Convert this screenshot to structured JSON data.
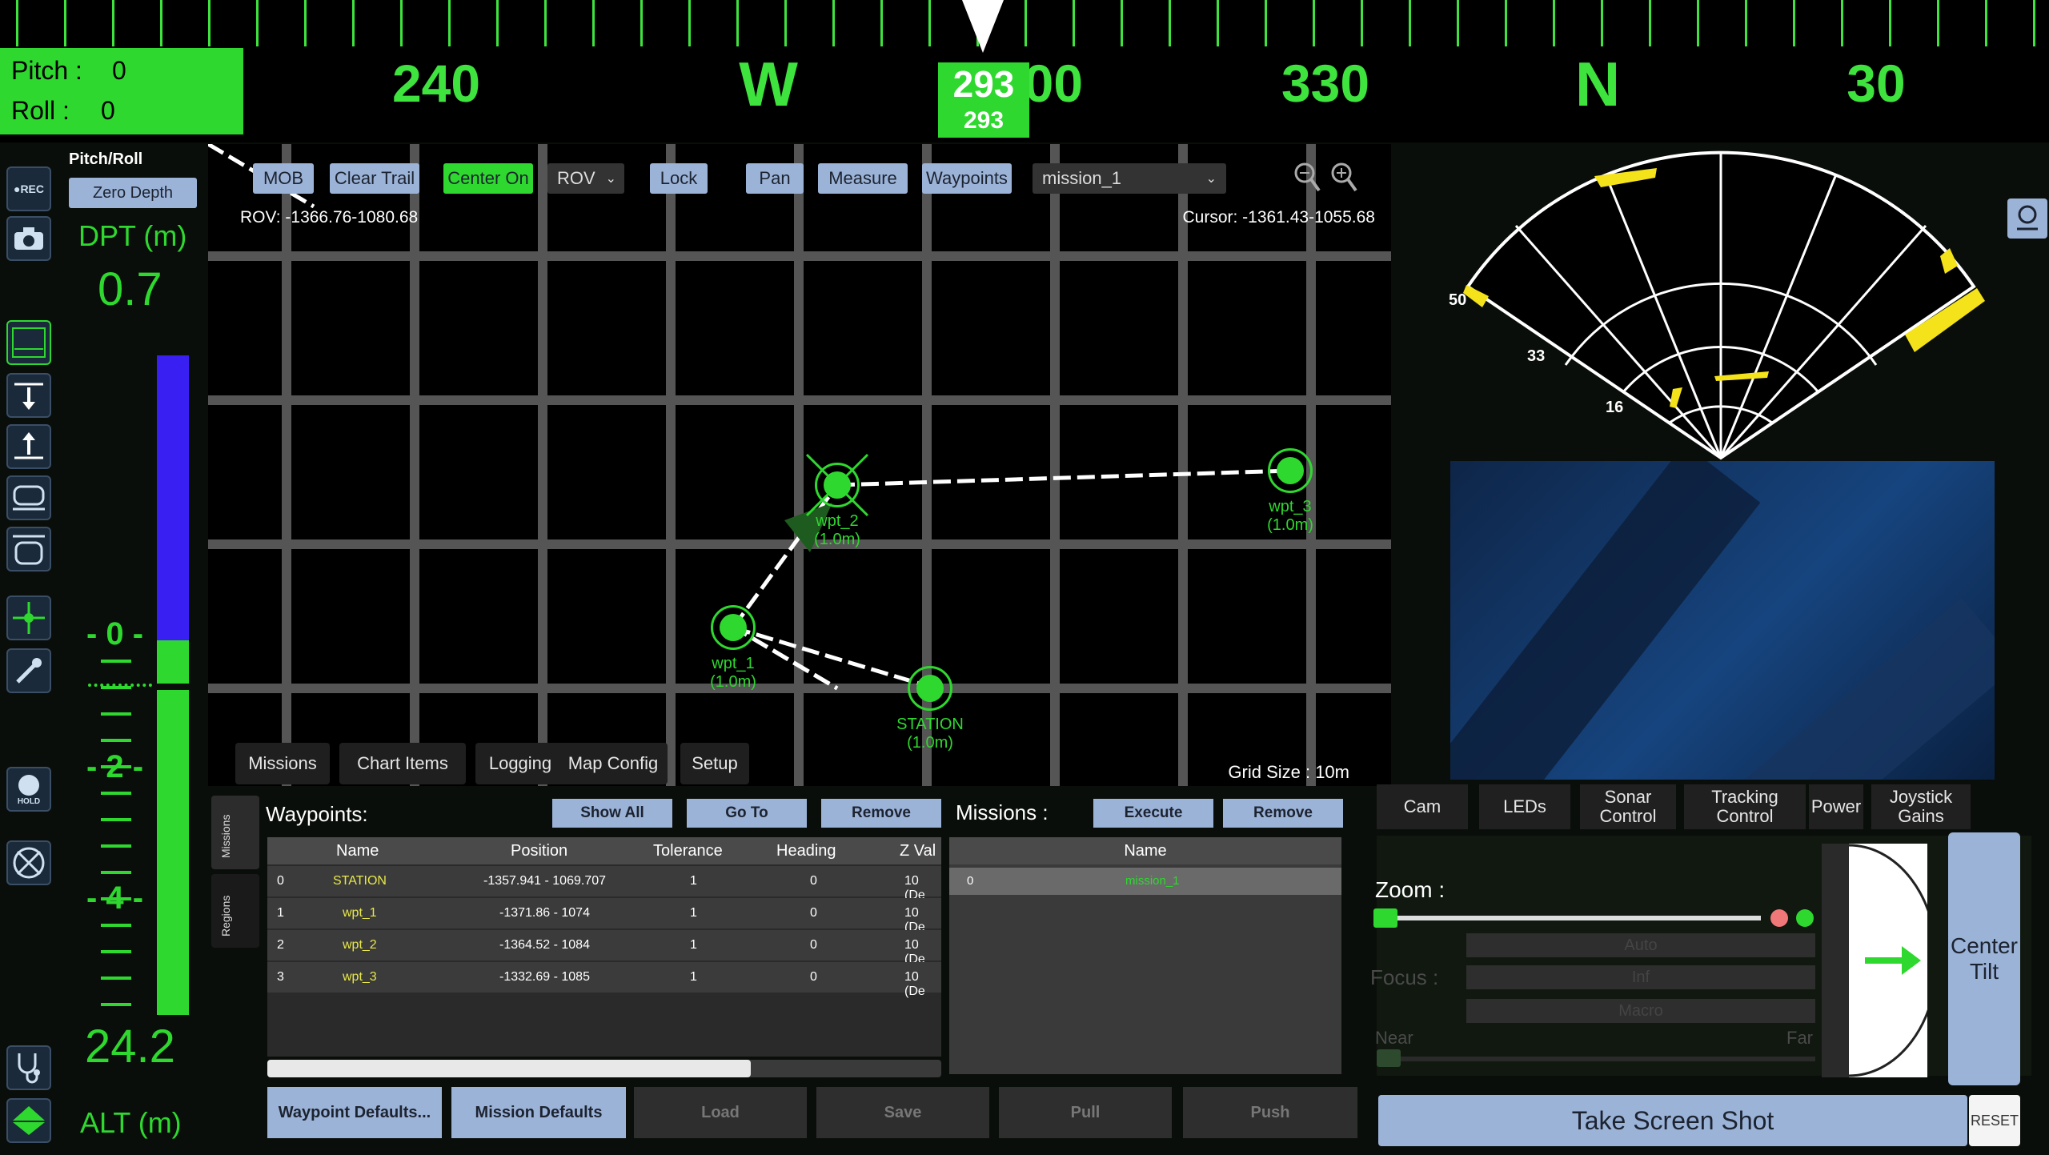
{
  "compass": {
    "labels": [
      "240",
      "W",
      "300",
      "330",
      "N",
      "30"
    ],
    "heading": "293",
    "heading_sub": "293"
  },
  "attitude": {
    "pitch_label": "Pitch :",
    "pitch_value": "0",
    "roll_label": "Roll :",
    "roll_value": "0"
  },
  "left_icons": {
    "rec_label": "●REC",
    "hold_label": "HOLD"
  },
  "depth": {
    "pitch_roll_label": "Pitch/Roll",
    "zero_depth": "Zero Depth",
    "dpt_label": "DPT (m)",
    "dpt_value": "0.7",
    "scale": [
      "- 0 -",
      "- 2 -",
      "- 4 -"
    ],
    "alt_value": "24.2",
    "alt_label": "ALT (m)",
    "depth_fill_fraction": 0.14
  },
  "map": {
    "toolbar": {
      "mob": "MOB",
      "clear_trail": "Clear Trail",
      "center_on": "Center On",
      "rov_select": "ROV",
      "lock": "Lock",
      "pan": "Pan",
      "measure": "Measure",
      "waypoints": "Waypoints",
      "mission_select": "mission_1"
    },
    "rov_position": "ROV: -1366.76-1080.68",
    "cursor_position": "Cursor: -1361.43-1055.68",
    "grid_size": "Grid Size : 10m",
    "waypoints": [
      {
        "name": "wpt_1",
        "tol": "(1.0m)"
      },
      {
        "name": "wpt_2",
        "tol": "(1.0m)"
      },
      {
        "name": "wpt_3",
        "tol": "(1.0m)"
      },
      {
        "name": "STATION",
        "tol": "(1.0m)"
      }
    ],
    "tabs": [
      "Missions",
      "Chart Items",
      "Logging",
      "Map Config",
      "Setup"
    ]
  },
  "waypoint_panel": {
    "side_tabs": [
      "Missions",
      "Regions"
    ],
    "title": "Waypoints:",
    "show_all": "Show All",
    "go_to": "Go To",
    "remove": "Remove",
    "columns": [
      "Name",
      "Position",
      "Tolerance",
      "Heading",
      "Z Val"
    ],
    "rows": [
      {
        "idx": "0",
        "name": "STATION",
        "pos": "-1357.941 - 1069.707",
        "tol": "1",
        "hdg": "0",
        "z": "10 (De"
      },
      {
        "idx": "1",
        "name": "wpt_1",
        "pos": "-1371.86 - 1074",
        "tol": "1",
        "hdg": "0",
        "z": "10 (De"
      },
      {
        "idx": "2",
        "name": "wpt_2",
        "pos": "-1364.52 - 1084",
        "tol": "1",
        "hdg": "0",
        "z": "10 (De"
      },
      {
        "idx": "3",
        "name": "wpt_3",
        "pos": "-1332.69 - 1085",
        "tol": "1",
        "hdg": "0",
        "z": "10 (De"
      }
    ]
  },
  "missions_panel": {
    "title": "Missions :",
    "execute": "Execute",
    "remove": "Remove",
    "column": "Name",
    "rows": [
      {
        "idx": "0",
        "name": "mission_1"
      }
    ]
  },
  "bottom_buttons": {
    "waypoint_defaults": "Waypoint Defaults...",
    "mission_defaults": "Mission Defaults",
    "load": "Load",
    "save": "Save",
    "pull": "Pull",
    "push": "Push"
  },
  "sonar": {
    "range_labels": [
      "50",
      "33",
      "16"
    ]
  },
  "right_tabs": [
    "Cam",
    "LEDs",
    "Sonar Control",
    "Tracking Control",
    "Power",
    "Joystick Gains"
  ],
  "camera": {
    "zoom_label": "Zoom :",
    "focus_label": "Focus :",
    "focus_options": [
      "Auto",
      "Inf",
      "Macro"
    ],
    "near_label": "Near",
    "far_label": "Far",
    "center_tilt": "Center Tilt",
    "screenshot": "Take Screen Shot",
    "reset": "RESET"
  }
}
